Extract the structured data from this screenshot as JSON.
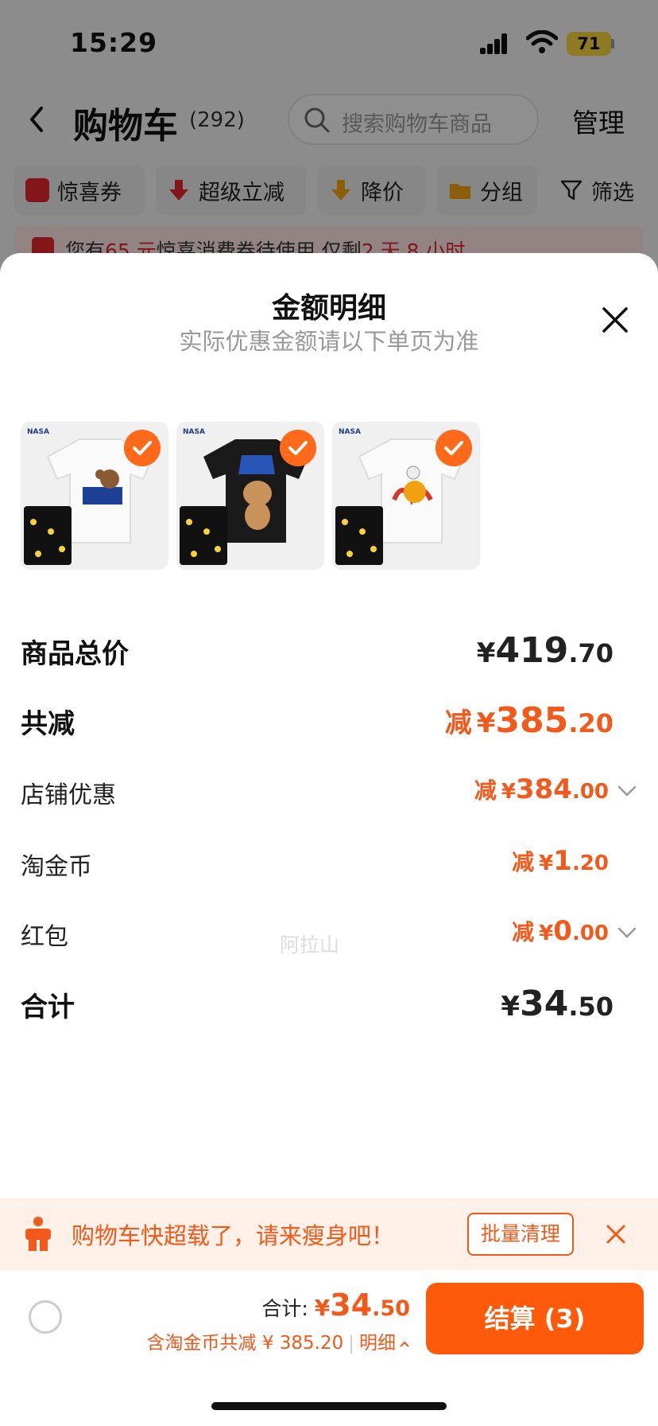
{
  "status": {
    "time": "15:29",
    "battery": "71"
  },
  "nav": {
    "title": "购物车",
    "count": "(292)",
    "search_placeholder": "搜索购物车商品",
    "manage": "管理"
  },
  "filters": [
    {
      "label": "惊喜券",
      "icon": "coupon-icon",
      "color": "#e0262b"
    },
    {
      "label": "超级立减",
      "icon": "down-arrow-icon",
      "color": "#e0262b"
    },
    {
      "label": "降价",
      "icon": "price-drop-icon",
      "color": "#f2a310"
    },
    {
      "label": "分组",
      "icon": "folder-icon",
      "color": "#f2a310"
    },
    {
      "label": "筛选",
      "icon": "filter-icon",
      "color": "#222222"
    }
  ],
  "notice": {
    "prefix": "您有",
    "amount": "65 元",
    "middle": "惊喜消费券待使用,仅剩",
    "remaining": "2 天 8 小时"
  },
  "sheet": {
    "title": "金额明细",
    "subtitle": "实际优惠金额请以下单页为准",
    "products": [
      {
        "name": "nasa-bear-white-tee",
        "color": "#ffffff"
      },
      {
        "name": "nasa-bear-black-tee",
        "color": "#1a1a1a"
      },
      {
        "name": "nasa-astronaut-white-tee",
        "color": "#ffffff"
      }
    ],
    "rows": {
      "subtotal": {
        "label": "商品总价",
        "yen": "¥",
        "int": "419",
        "dec": ".70"
      },
      "total_discount": {
        "label": "共减",
        "prefix": "减",
        "yen": "¥",
        "int": "385",
        "dec": ".20"
      },
      "store_discount": {
        "label": "店铺优惠",
        "prefix": "减",
        "yen": "¥",
        "int": "384",
        "dec": ".00"
      },
      "coins": {
        "label": "淘金币",
        "prefix": "减",
        "yen": "¥",
        "int": "1",
        "dec": ".20"
      },
      "red_packet": {
        "label": "红包",
        "prefix": "减",
        "yen": "¥",
        "int": "0",
        "dec": ".00"
      },
      "total": {
        "label": "合计",
        "yen": "¥",
        "int": "34",
        "dec": ".50"
      }
    },
    "watermark": "阿拉山"
  },
  "banner": {
    "text": "购物车快超载了，请来瘦身吧！",
    "button": "批量清理"
  },
  "checkout": {
    "total_label": "合计:",
    "yen": "¥",
    "int": "34",
    "dec": ".50",
    "saving": "含淘金币共减 ¥ 385.20",
    "detail": "明细",
    "button": "结算 (3)"
  }
}
